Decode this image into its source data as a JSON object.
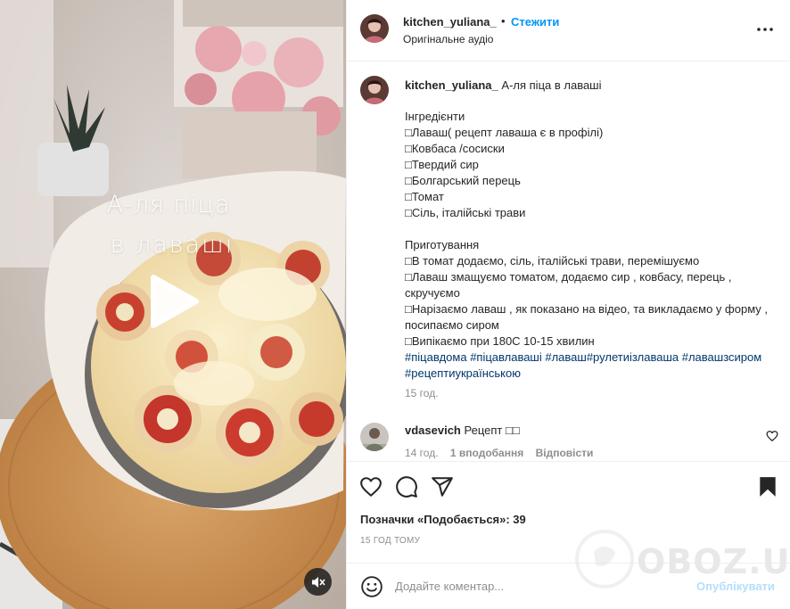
{
  "media": {
    "overlay_line1": "А-ля піца",
    "overlay_line2": "в лаваші",
    "play_icon": "play-icon",
    "mute_icon": "speaker-muted-icon"
  },
  "header": {
    "username": "kitchen_yuliana_",
    "dot": "•",
    "follow_label": "Стежити",
    "audio_label": "Оригінальне аудіо",
    "more_icon": "more-horizontal-icon"
  },
  "caption": {
    "username": "kitchen_yuliana_",
    "title": "А-ля піца в лаваші",
    "ingredients_heading": "Інгредієнти",
    "ingredients": [
      "Лаваш( рецепт лаваша є в профілі)",
      "Ковбаса /сосиски",
      "Твердий сир",
      "Болгарський перець",
      "Томат",
      "Сіль, італійські трави"
    ],
    "steps_heading": "Приготування",
    "steps": [
      "В томат додаємо, сіль, італійські трави, перемішуємо",
      "Лаваш змащуємо томатом, додаємо сир , ковбасу, перець , скручуємо",
      "Нарізаємо лаваш , як показано на відео, та викладаємо у форму , посипаємо сиром",
      "Випікаємо при 180С 10-15 хвилин"
    ],
    "hashtags": "#піцавдома #піцавлаваші #лаваш#рулетиізлаваша #лавашзсиром #рецептиукраїнською",
    "time": "15 год."
  },
  "comment": {
    "username": "vdasevich",
    "text": "Рецепт",
    "time": "14 год.",
    "likes": "1 вподобання",
    "reply_label": "Відповісти",
    "like_icon": "heart-outline-small-icon"
  },
  "actions": {
    "like_icon": "heart-icon",
    "comment_icon": "comment-icon",
    "share_icon": "share-icon",
    "save_icon": "bookmark-icon",
    "likes_text": "Позначки «Подобається»: 39",
    "ago_text": "15 ГОД ТОМУ"
  },
  "composer": {
    "emoji_icon": "emoji-icon",
    "placeholder": "Додайте коментар...",
    "post_label": "Опублікувати"
  },
  "watermark": {
    "text": "OBOZ.UA"
  }
}
